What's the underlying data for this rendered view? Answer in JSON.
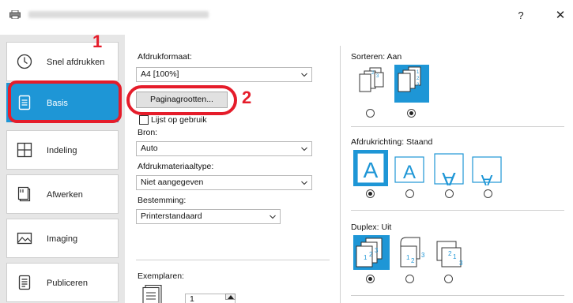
{
  "window": {
    "help_label": "?",
    "close_label": "✕"
  },
  "callouts": {
    "one": "1",
    "two": "2"
  },
  "sidebar": {
    "items": [
      {
        "label": "Snel afdrukken",
        "icon": "clock-icon"
      },
      {
        "label": "Basis",
        "icon": "document-icon"
      },
      {
        "label": "Indeling",
        "icon": "layout-grid-icon"
      },
      {
        "label": "Afwerken",
        "icon": "finishing-icon"
      },
      {
        "label": "Imaging",
        "icon": "image-icon"
      },
      {
        "label": "Publiceren",
        "icon": "publish-icon"
      }
    ]
  },
  "basic": {
    "paper_size_label": "Afdrukformaat:",
    "paper_size_value": "A4  [100%]",
    "page_sizes_button": "Paginagrootten...",
    "use_list_label": "Lijst op gebruik",
    "source_label": "Bron:",
    "source_value": "Auto",
    "media_type_label": "Afdrukmateriaaltype:",
    "media_type_value": "Niet aangegeven",
    "destination_label": "Bestemming:",
    "destination_value": "Printerstandaard",
    "copies_label": "Exemplaren:",
    "copies_value": "1"
  },
  "options": {
    "collate_label": "Sorteren:  Aan",
    "orientation_label": "Afdrukrichting:  Staand",
    "duplex_label": "Duplex:  Uit"
  },
  "colors": {
    "accent": "#1e96d6",
    "callout": "#e51c2a",
    "sidebar_bg": "#e6e6e6"
  }
}
